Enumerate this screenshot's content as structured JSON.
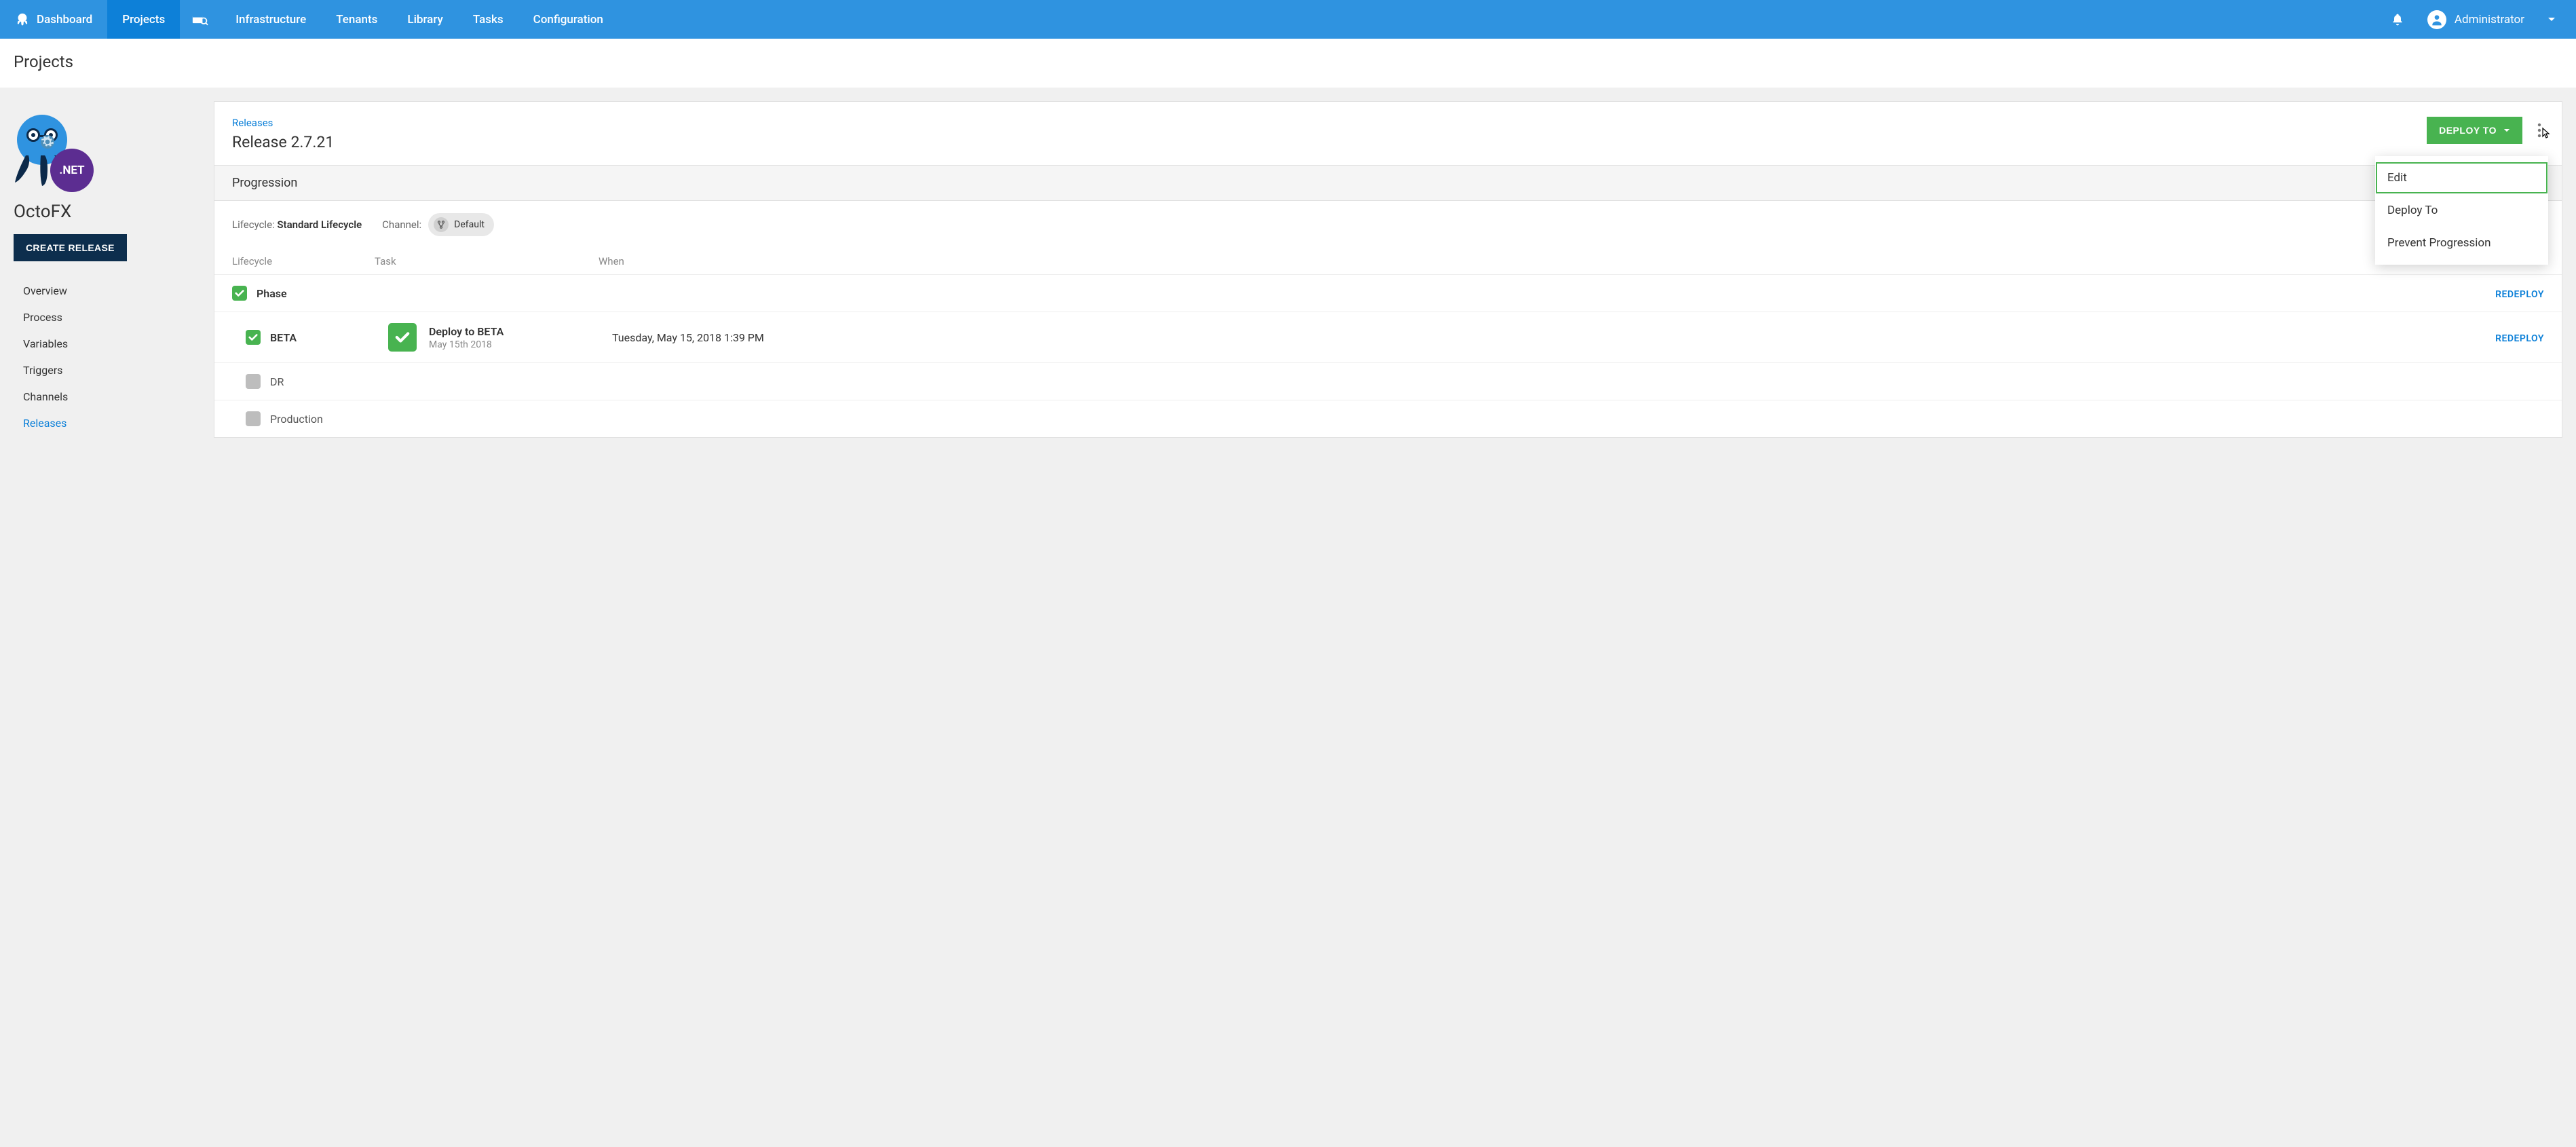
{
  "colors": {
    "brand_blue": "#2f93e0",
    "active_blue": "#0d80d8",
    "green": "#48b350",
    "dark_blue": "#0d2e4d",
    "purple": "#5c2d91"
  },
  "topnav": {
    "items": [
      {
        "label": "Dashboard"
      },
      {
        "label": "Projects",
        "active": true
      },
      {
        "label": "Infrastructure"
      },
      {
        "label": "Tenants"
      },
      {
        "label": "Library"
      },
      {
        "label": "Tasks"
      },
      {
        "label": "Configuration"
      }
    ],
    "user": "Administrator"
  },
  "page": {
    "title": "Projects"
  },
  "project": {
    "name": "OctoFX",
    "logo_badge": ".NET",
    "create_button": "CREATE RELEASE",
    "nav": [
      {
        "label": "Overview"
      },
      {
        "label": "Process"
      },
      {
        "label": "Variables"
      },
      {
        "label": "Triggers"
      },
      {
        "label": "Channels"
      },
      {
        "label": "Releases",
        "active": true
      }
    ]
  },
  "release": {
    "breadcrumb": "Releases",
    "title": "Release 2.7.21",
    "deploy_button": "DEPLOY TO",
    "overflow_menu": [
      {
        "label": "Edit",
        "highlight": true
      },
      {
        "label": "Deploy To"
      },
      {
        "label": "Prevent Progression"
      }
    ]
  },
  "progression": {
    "section_label": "Progression",
    "lifecycle_label": "Lifecycle:",
    "lifecycle_value": "Standard Lifecycle",
    "channel_label": "Channel:",
    "channel_value": "Default",
    "columns": {
      "lifecycle": "Lifecycle",
      "task": "Task",
      "when": "When"
    },
    "redeploy_label": "REDEPLOY",
    "phase": {
      "label": "Phase",
      "status": "success"
    },
    "rows": [
      {
        "env": "BETA",
        "status": "success",
        "task_title": "Deploy to BETA",
        "task_sub": "May 15th 2018",
        "when": "Tuesday, May 15, 2018 1:39 PM",
        "redeploy": true
      },
      {
        "env": "DR",
        "status": "pending"
      },
      {
        "env": "Production",
        "status": "pending"
      }
    ]
  }
}
